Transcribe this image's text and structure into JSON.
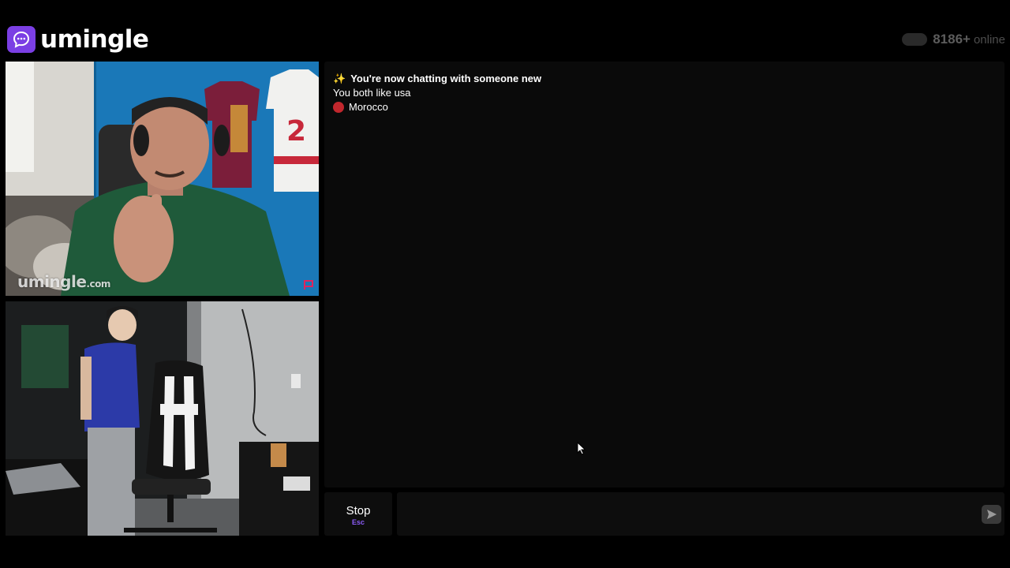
{
  "header": {
    "brand": "umingle",
    "online_count": "8186+",
    "online_label": "online"
  },
  "videos": {
    "stranger_watermark": "umingle",
    "stranger_watermark_suffix": ".com"
  },
  "chat": {
    "system_message": "You're now chatting with someone new",
    "common_interest": "You both like usa",
    "country": "Morocco"
  },
  "controls": {
    "stop_label": "Stop",
    "stop_shortcut": "Esc",
    "message_placeholder": ""
  },
  "colors": {
    "brand_purple": "#7b3fe4",
    "shortcut_purple": "#8b5cf6",
    "flag_red": "#c1272d"
  },
  "icons": {
    "logo": "chat-bubble-icon",
    "send": "send-arrow-icon",
    "report": "report-flag-icon"
  }
}
